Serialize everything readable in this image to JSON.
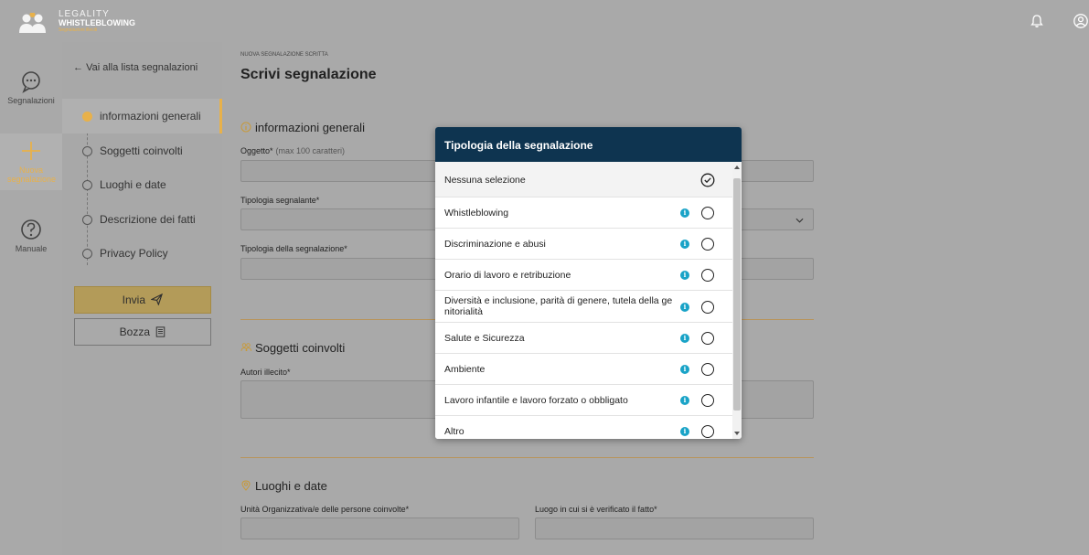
{
  "app": {
    "logo_line1": "LEGALITY",
    "logo_line2": "WHISTLEBLOWING",
    "logo_line3": "Segnalazioni illeciti"
  },
  "topbar": {
    "icons": [
      "bell-icon",
      "user-circle-icon"
    ]
  },
  "rail": {
    "items": [
      {
        "label": "Segnalazioni",
        "icon": "chat-bubble-icon"
      },
      {
        "label": "Nuova segnalazione",
        "icon": "plus-icon",
        "active": true
      },
      {
        "label": "Manuale",
        "icon": "question-icon"
      }
    ]
  },
  "steps": {
    "back_label": "Vai alla lista segnalazioni",
    "items": [
      {
        "label": "informazioni generali",
        "active": true
      },
      {
        "label": "Soggetti coinvolti"
      },
      {
        "label": "Luoghi e date"
      },
      {
        "label": "Descrizione dei fatti"
      },
      {
        "label": "Privacy Policy"
      }
    ],
    "invia_label": "Invia",
    "bozza_label": "Bozza"
  },
  "main": {
    "breadcrumb": "NUOVA SEGNALAZIONE SCRITTA",
    "title": "Scrivi segnalazione",
    "section_general": "informazioni generali",
    "oggetto_label": "Oggetto*",
    "oggetto_hint": "(max 100 caratteri)",
    "tipologia_segnalante_label": "Tipologia segnalante*",
    "tipologia_segnalazione_label": "Tipologia della segnalazione*",
    "section_soggetti": "Soggetti coinvolti",
    "autori_label": "Autori illecito*",
    "section_luoghi": "Luoghi e date",
    "unita_label": "Unità Organizzativa/e delle persone coinvolte*",
    "luogo_label": "Luogo in cui si è verificato il fatto*"
  },
  "modal": {
    "title": "Tipologia della segnalazione",
    "options": [
      {
        "label": "Nessuna selezione",
        "selected": true,
        "info": false
      },
      {
        "label": "Whistleblowing",
        "selected": false,
        "info": true
      },
      {
        "label": "Discriminazione e abusi",
        "selected": false,
        "info": true
      },
      {
        "label": "Orario di lavoro e retribuzione",
        "selected": false,
        "info": true
      },
      {
        "label": "Diversità e inclusione, parità di genere, tutela della ge nitorialità",
        "selected": false,
        "info": true
      },
      {
        "label": "Salute e Sicurezza",
        "selected": false,
        "info": true
      },
      {
        "label": "Ambiente",
        "selected": false,
        "info": true
      },
      {
        "label": "Lavoro infantile e lavoro forzato o obbligato",
        "selected": false,
        "info": true
      },
      {
        "label": "Altro",
        "selected": false,
        "info": true
      }
    ]
  },
  "colors": {
    "accent": "#e8b14a",
    "modal_header": "#0e3450",
    "info": "#19a3c7",
    "overlay": "#a9a9a9"
  }
}
